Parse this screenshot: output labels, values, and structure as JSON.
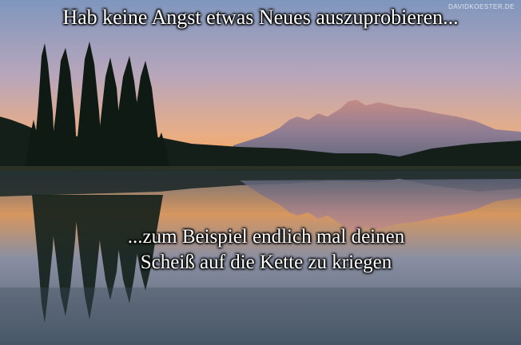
{
  "top_caption": "Hab keine Angst etwas Neues auszuprobieren...",
  "bottom_caption_line1": "...zum Beispiel endlich mal deinen",
  "bottom_caption_line2": "Scheiß auf die Kette zu kriegen",
  "watermark": "DAVIDKOESTER.DE",
  "colors": {
    "sky_top": "#8da2c4",
    "sky_horizon": "#f2a75a",
    "mountain": "#9a7f8e",
    "forest": "#121d17",
    "water": "#5e6f83"
  }
}
